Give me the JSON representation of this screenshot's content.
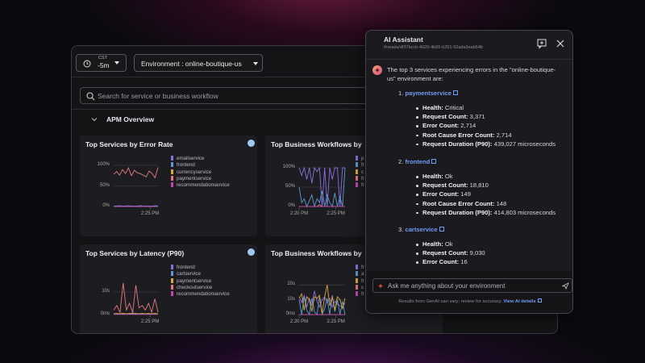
{
  "toolbar": {
    "timezone": "CST",
    "time_range": "-5m",
    "environment": "Environment : online-boutique-us"
  },
  "search": {
    "placeholder": "Search for service or business workflow"
  },
  "section": {
    "title": "APM Overview"
  },
  "colors": {
    "purple": "#8b6fe0",
    "blue": "#5b9bd5",
    "yellow": "#d8a83a",
    "pink": "#e07a80",
    "magenta": "#c04aa8",
    "status_dot": "#9ccaf2",
    "accent_link": "#6f9cf5"
  },
  "chart_data": [
    {
      "type": "line",
      "title": "Top Services by Error Rate",
      "ylim": [
        0,
        100
      ],
      "yticks": [
        "100%",
        "50%",
        "0%"
      ],
      "ytick_values": [
        100,
        50,
        0
      ],
      "xticks": [
        "2:25 PM"
      ],
      "legend": "right",
      "series": [
        {
          "name": "emailservice",
          "color": "#8b6fe0",
          "values": [
            1,
            1,
            2,
            1,
            1,
            2,
            1,
            1,
            1,
            2,
            1,
            1,
            1,
            1,
            2,
            1
          ]
        },
        {
          "name": "frontend",
          "color": "#5b9bd5",
          "values": [
            0,
            1,
            0,
            1,
            1,
            0,
            1,
            0,
            1,
            1,
            0,
            1,
            0,
            1,
            0,
            1
          ]
        },
        {
          "name": "currencyservice",
          "color": "#d8a83a",
          "values": [
            0,
            0,
            0,
            0,
            0,
            0,
            0,
            0,
            0,
            0,
            0,
            0,
            0,
            0,
            0,
            0
          ]
        },
        {
          "name": "paymentservice",
          "color": "#e07a80",
          "values": [
            78,
            85,
            76,
            90,
            80,
            94,
            75,
            88,
            82,
            80,
            76,
            72,
            86,
            80,
            70,
            95
          ]
        },
        {
          "name": "recommendationservice",
          "color": "#c04aa8",
          "values": [
            0,
            0,
            0,
            0,
            0,
            0,
            0,
            0,
            0,
            0,
            0,
            0,
            0,
            0,
            0,
            0
          ]
        }
      ]
    },
    {
      "type": "line",
      "title": "Top Business Workflows by",
      "ylim": [
        0,
        100
      ],
      "yticks": [
        "100%",
        "50%",
        "0%"
      ],
      "ytick_values": [
        100,
        50,
        0
      ],
      "xticks": [
        "2:20 PM",
        "2:25 PM"
      ],
      "legend": "right",
      "series": [
        {
          "name": "p",
          "color": "#8b6fe0",
          "values": [
            100,
            80,
            100,
            70,
            100,
            60,
            100,
            90,
            100,
            0,
            100,
            0,
            100,
            70,
            100,
            100,
            0,
            100,
            100
          ]
        },
        {
          "name": "fr",
          "color": "#5b9bd5",
          "values": [
            50,
            10,
            20,
            0,
            15,
            30,
            0,
            20,
            10,
            40,
            0,
            30,
            10,
            0,
            35,
            0,
            25,
            0,
            100
          ]
        },
        {
          "name": "c",
          "color": "#d8a83a",
          "values": [
            0,
            0,
            0,
            0,
            0,
            0,
            0,
            0,
            0,
            0,
            0,
            0,
            0,
            0,
            0,
            0,
            0,
            0,
            0
          ]
        },
        {
          "name": "fr",
          "color": "#e07a80",
          "values": [
            0,
            0,
            0,
            0,
            0,
            0,
            0,
            0,
            5,
            0,
            0,
            0,
            0,
            0,
            0,
            0,
            0,
            0,
            0
          ]
        },
        {
          "name": "fr",
          "color": "#c04aa8",
          "values": [
            0,
            0,
            0,
            0,
            0,
            0,
            0,
            0,
            0,
            0,
            0,
            0,
            0,
            0,
            0,
            0,
            0,
            0,
            0
          ]
        }
      ]
    },
    {
      "type": "line",
      "title": "Top Services by Latency (P90)",
      "ylim": [
        0,
        15
      ],
      "yticks": [
        "10s",
        "0ms"
      ],
      "ytick_values": [
        10,
        0
      ],
      "xticks": [
        "2:25 PM"
      ],
      "legend": "right",
      "series": [
        {
          "name": "frontend",
          "color": "#8b6fe0",
          "values": [
            0.3,
            0.4,
            0.3,
            0.6,
            0.3,
            0.4,
            0.8,
            0.3,
            0.4,
            0.5,
            0.3,
            0.4,
            0.3,
            0.4,
            0.3
          ]
        },
        {
          "name": "cartservice",
          "color": "#5b9bd5",
          "values": [
            0.2,
            0.3,
            0.2,
            0.3,
            0.2,
            0.3,
            0.2,
            0.3,
            0.2,
            0.3,
            0.2,
            0.3,
            0.2,
            0.3,
            0.2
          ]
        },
        {
          "name": "paymentservice",
          "color": "#d8a83a",
          "values": [
            0.4,
            0.5,
            0.4,
            0.5,
            0.4,
            0.5,
            0.4,
            0.5,
            0.4,
            0.5,
            0.4,
            0.5,
            0.4,
            0.5,
            0.4
          ]
        },
        {
          "name": "checkoutservice",
          "color": "#e07a80",
          "values": [
            2,
            4,
            1,
            14,
            2,
            5,
            1,
            13,
            3,
            4,
            2,
            5,
            1,
            7,
            1
          ]
        },
        {
          "name": "recommendationservice",
          "color": "#c04aa8",
          "values": [
            0.1,
            0.1,
            0.1,
            0.1,
            0.1,
            0.1,
            0.1,
            0.1,
            0.1,
            0.1,
            0.1,
            0.1,
            0.1,
            0.1,
            0.1
          ]
        }
      ]
    },
    {
      "type": "line",
      "title": "Top Business Workflows by",
      "ylim": [
        0,
        25
      ],
      "yticks": [
        "20s",
        "10s",
        "0ms"
      ],
      "ytick_values": [
        20,
        10,
        0
      ],
      "xticks": [
        "2:20 PM",
        "2:25 PM"
      ],
      "legend": "right",
      "series": [
        {
          "name": "fr",
          "color": "#8b6fe0",
          "values": [
            12,
            8,
            13,
            5,
            11,
            6,
            16,
            9,
            5,
            10,
            12,
            8,
            11,
            5,
            9,
            7,
            6,
            5,
            8
          ]
        },
        {
          "name": "a",
          "color": "#5b9bd5",
          "values": [
            10,
            0,
            12,
            3,
            0,
            11,
            2,
            0,
            12,
            0,
            4,
            11,
            0,
            13,
            2,
            10,
            0,
            9,
            0
          ]
        },
        {
          "name": "fr",
          "color": "#d8a83a",
          "values": [
            11,
            14,
            3,
            12,
            10,
            2,
            12,
            11,
            13,
            1,
            12,
            20,
            6,
            12,
            3,
            12,
            10,
            4,
            11
          ]
        },
        {
          "name": "c",
          "color": "#e07a80",
          "values": [
            0,
            0,
            0,
            0,
            0,
            0,
            0,
            0,
            0,
            0,
            0,
            0,
            0,
            0,
            0,
            0,
            0,
            0,
            0
          ]
        },
        {
          "name": "fr",
          "color": "#c04aa8",
          "values": [
            0,
            0,
            0,
            0,
            0,
            0,
            0,
            0,
            0,
            0,
            0,
            0,
            0,
            0,
            0,
            0,
            0,
            0,
            0
          ]
        }
      ]
    }
  ],
  "chat": {
    "title": "AI Assistant",
    "thread": "threads/df37bccb-4020-4b65-b251-92ada3eab64b",
    "intro_1": "The top 3 services experiencing errors in the \"online-boutique-",
    "intro_2": "us\" environment are:",
    "services": [
      {
        "num": "1.",
        "name": "paymentservice",
        "fields": [
          [
            "Health:",
            "Critical"
          ],
          [
            "Request Count:",
            "3,371"
          ],
          [
            "Error Count:",
            "2,714"
          ],
          [
            "Root Cause Error Count:",
            "2,714"
          ],
          [
            "Request Duration (P90):",
            "439,027 microseconds"
          ]
        ]
      },
      {
        "num": "2.",
        "name": "frontend",
        "fields": [
          [
            "Health:",
            "Ok"
          ],
          [
            "Request Count:",
            "18,810"
          ],
          [
            "Error Count:",
            "149"
          ],
          [
            "Root Cause Error Count:",
            "148"
          ],
          [
            "Request Duration (P90):",
            "414,803 microseconds"
          ]
        ]
      },
      {
        "num": "3.",
        "name": "cartservice",
        "fields": [
          [
            "Health:",
            "Ok"
          ],
          [
            "Request Count:",
            "9,030"
          ],
          [
            "Error Count:",
            "16"
          ]
        ]
      }
    ],
    "input_placeholder": "Ask me anything about your environment",
    "disclaimer": "Results from GenAI can vary; review for accuracy.",
    "details_link": "View AI details"
  }
}
